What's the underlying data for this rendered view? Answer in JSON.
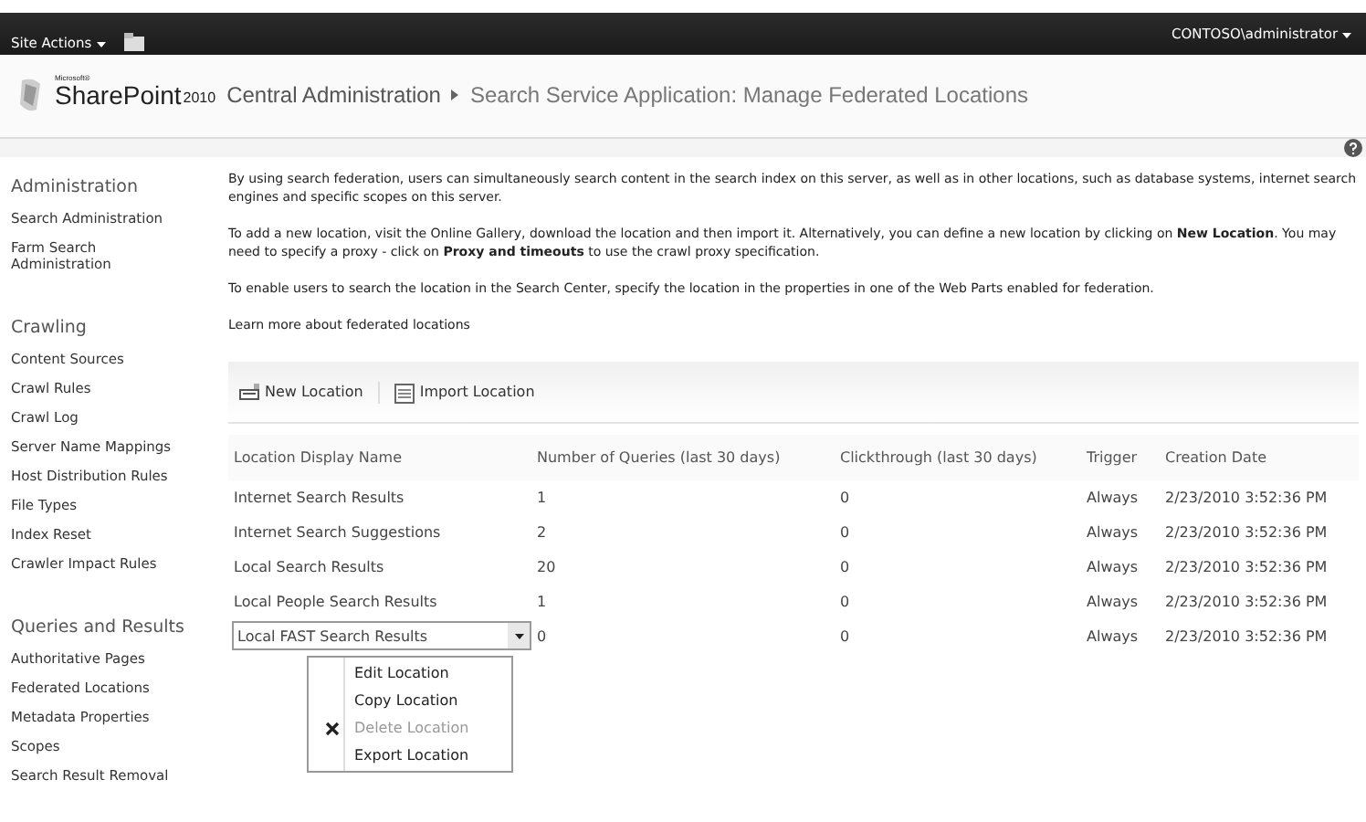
{
  "top_bar": {
    "site_actions": "Site Actions",
    "user": "CONTOSO\\administrator"
  },
  "header": {
    "logo_small": "Microsoft®",
    "logo": "SharePoint",
    "logo_year": "2010",
    "breadcrumb": "Central Administration",
    "page_title": "Search Service Application: Manage Federated Locations"
  },
  "sidebar": {
    "sections": [
      {
        "title": "Administration",
        "items": [
          "Search Administration",
          "Farm Search Administration"
        ]
      },
      {
        "title": "Crawling",
        "items": [
          "Content Sources",
          "Crawl Rules",
          "Crawl Log",
          "Server Name Mappings",
          "Host Distribution Rules",
          "File Types",
          "Index Reset",
          "Crawler Impact Rules"
        ]
      },
      {
        "title": "Queries and Results",
        "items": [
          "Authoritative Pages",
          "Federated Locations",
          "Metadata Properties",
          "Scopes",
          "Search Result Removal"
        ]
      }
    ]
  },
  "intro": [
    "By using search federation, users can simultaneously search content in the search index on this server, as well as in other locations, such as database systems, internet search engines and specific scopes on this server.",
    "To add a new location, visit the Online Gallery, download the location and then import it. Alternatively, you can define a new location by clicking on **New Location**. You may need to specify a proxy - click on **Proxy and timeouts** to use the crawl proxy specification.",
    "To enable users to search the location in the Search Center, specify the location in the properties in one of the Web Parts enabled for federation."
  ],
  "learn_more": "Learn more about federated locations",
  "toolbar": [
    "New Location",
    "Import Location"
  ],
  "table": {
    "columns": [
      "Location Display Name",
      "Number of Queries (last 30 days)",
      "Clickthrough (last 30 days)",
      "Trigger",
      "Creation Date"
    ],
    "rows": [
      {
        "cells": [
          "Internet Search Results",
          "1",
          "0",
          "Always",
          "2/23/2010 3:52:36 PM"
        ],
        "selected": false
      },
      {
        "cells": [
          "Internet Search Suggestions",
          "2",
          "0",
          "Always",
          "2/23/2010 3:52:36 PM"
        ],
        "selected": false
      },
      {
        "cells": [
          "Local Search Results",
          "20",
          "0",
          "Always",
          "2/23/2010 3:52:36 PM"
        ],
        "selected": false
      },
      {
        "cells": [
          "Local People Search Results",
          "1",
          "0",
          "Always",
          "2/23/2010 3:52:36 PM"
        ],
        "selected": false
      },
      {
        "cells": [
          "Local FAST Search Results",
          "0",
          "0",
          "Always",
          "2/23/2010 3:52:36 PM"
        ],
        "selected": true
      }
    ]
  },
  "context_menu": [
    {
      "label": "Edit Location",
      "kind": "plain",
      "disabled": false
    },
    {
      "label": "Copy Location",
      "kind": "plain",
      "disabled": false
    },
    {
      "label": "Delete Location",
      "kind": "delete",
      "disabled": true
    },
    {
      "label": "Export Location",
      "kind": "plain",
      "disabled": false
    }
  ]
}
